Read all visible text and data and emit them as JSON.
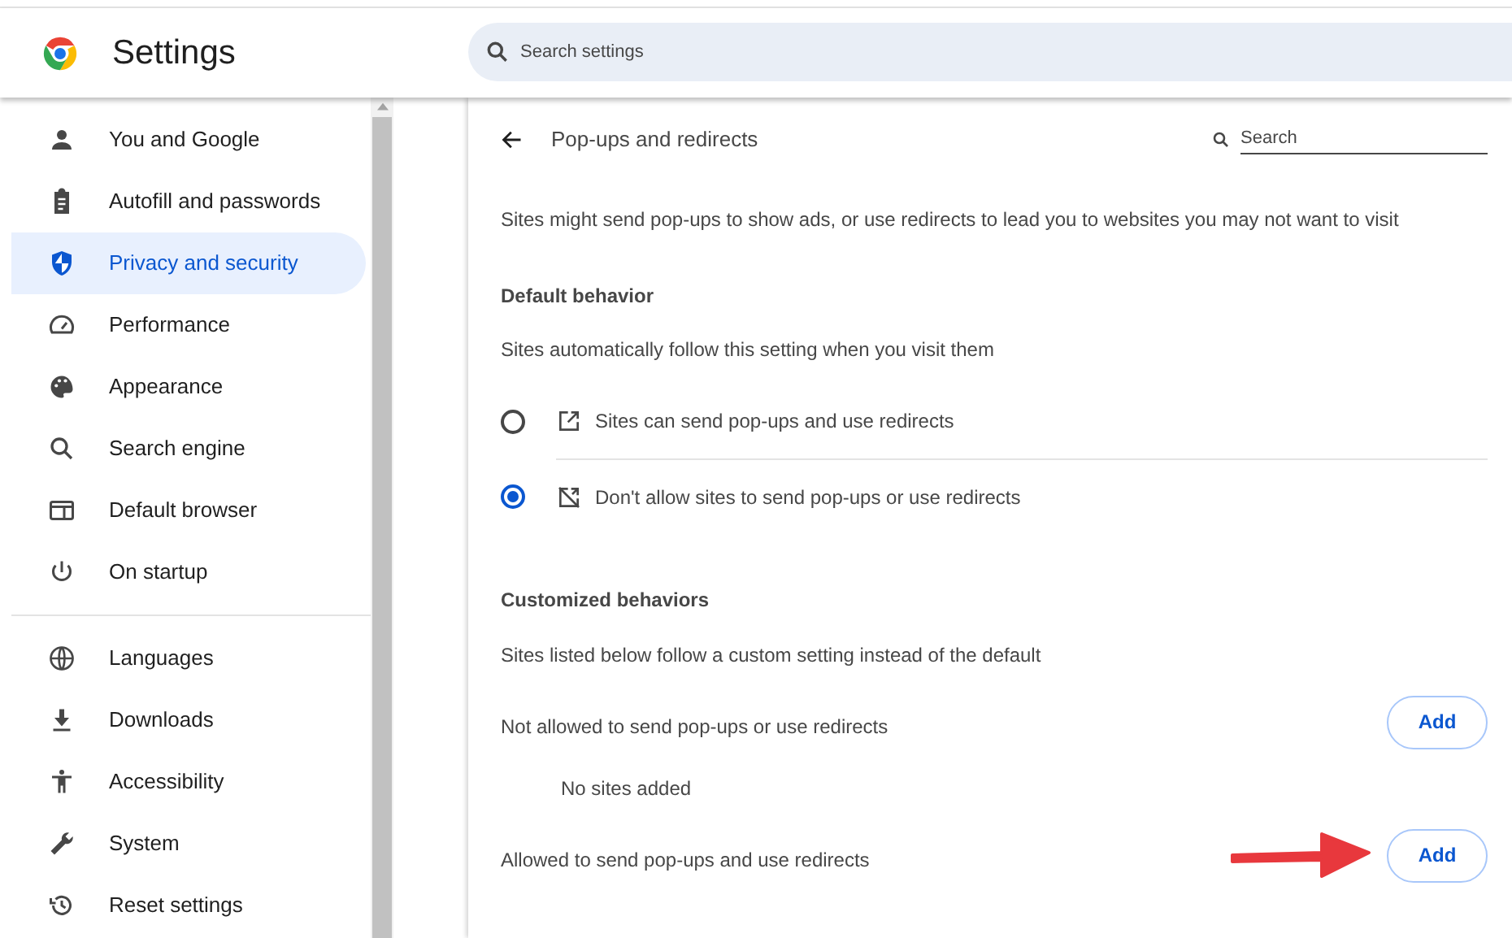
{
  "header": {
    "title": "Settings",
    "search": {
      "placeholder": "Search settings"
    }
  },
  "sidebar": {
    "sections": [
      [
        {
          "label": "You and Google",
          "selected": false
        },
        {
          "label": "Autofill and passwords",
          "selected": false
        },
        {
          "label": "Privacy and security",
          "selected": true
        },
        {
          "label": "Performance",
          "selected": false
        },
        {
          "label": "Appearance",
          "selected": false
        },
        {
          "label": "Search engine",
          "selected": false
        },
        {
          "label": "Default browser",
          "selected": false
        },
        {
          "label": "On startup",
          "selected": false
        }
      ],
      [
        {
          "label": "Languages",
          "selected": false
        },
        {
          "label": "Downloads",
          "selected": false
        },
        {
          "label": "Accessibility",
          "selected": false
        },
        {
          "label": "System",
          "selected": false
        },
        {
          "label": "Reset settings",
          "selected": false
        }
      ]
    ]
  },
  "page": {
    "title": "Pop-ups and redirects",
    "search": {
      "placeholder": "Search"
    },
    "description": "Sites might send pop-ups to show ads, or use redirects to lead you to websites you may not want to visit",
    "default_behavior": {
      "heading": "Default behavior",
      "subtitle": "Sites automatically follow this setting when you visit them",
      "options": [
        {
          "label": "Sites can send pop-ups and use redirects",
          "selected": false
        },
        {
          "label": "Don't allow sites to send pop-ups or use redirects",
          "selected": true
        }
      ]
    },
    "customized": {
      "heading": "Customized behaviors",
      "subtitle": "Sites listed below follow a custom setting instead of the default",
      "lists": [
        {
          "label": "Not allowed to send pop-ups or use redirects",
          "button": "Add",
          "empty_text": "No sites added",
          "highlighted": false
        },
        {
          "label": "Allowed to send pop-ups and use redirects",
          "button": "Add",
          "highlighted": true
        }
      ]
    }
  }
}
